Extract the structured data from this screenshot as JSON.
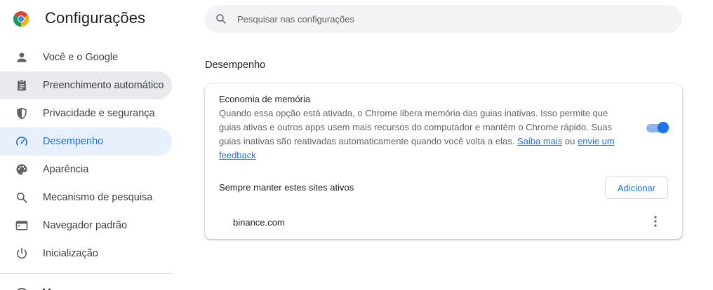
{
  "app": {
    "title": "Configurações",
    "logo_icon": "chrome-logo"
  },
  "search": {
    "placeholder": "Pesquisar nas configurações",
    "value": ""
  },
  "sidebar": {
    "items": [
      {
        "label": "Você e o Google",
        "icon": "person-icon"
      },
      {
        "label": "Preenchimento automático",
        "icon": "clipboard-icon",
        "state": "hover"
      },
      {
        "label": "Privacidade e segurança",
        "icon": "shield-icon"
      },
      {
        "label": "Desempenho",
        "icon": "speedometer-icon",
        "state": "active"
      },
      {
        "label": "Aparência",
        "icon": "palette-icon"
      },
      {
        "label": "Mecanismo de pesquisa",
        "icon": "search-icon"
      },
      {
        "label": "Navegador padrão",
        "icon": "browser-icon"
      },
      {
        "label": "Inicialização",
        "icon": "power-icon"
      }
    ]
  },
  "main": {
    "section_title": "Desempenho",
    "memory_saver": {
      "title": "Economia de memória",
      "description": "Quando essa opção está ativada, o Chrome libera memória das guias inativas. Isso permite que guias ativas e outros apps usem mais recursos do computador e mantém o Chrome rápido. Suas guias inativas são reativadas automaticamente quando você volta a elas.",
      "learn_more_link": "Saiba mais",
      "or_text": "ou",
      "feedback_link": "envie um feedback",
      "enabled": true,
      "always_active_label": "Sempre manter estes sites ativos",
      "add_button": "Adicionar",
      "sites": [
        {
          "name": "binance.com"
        }
      ]
    }
  },
  "colors": {
    "accent": "#1a73e8",
    "active_bg": "#e8f0fe",
    "hover_bg": "#e8eaed",
    "toggle_track": "#8ab4f8"
  }
}
